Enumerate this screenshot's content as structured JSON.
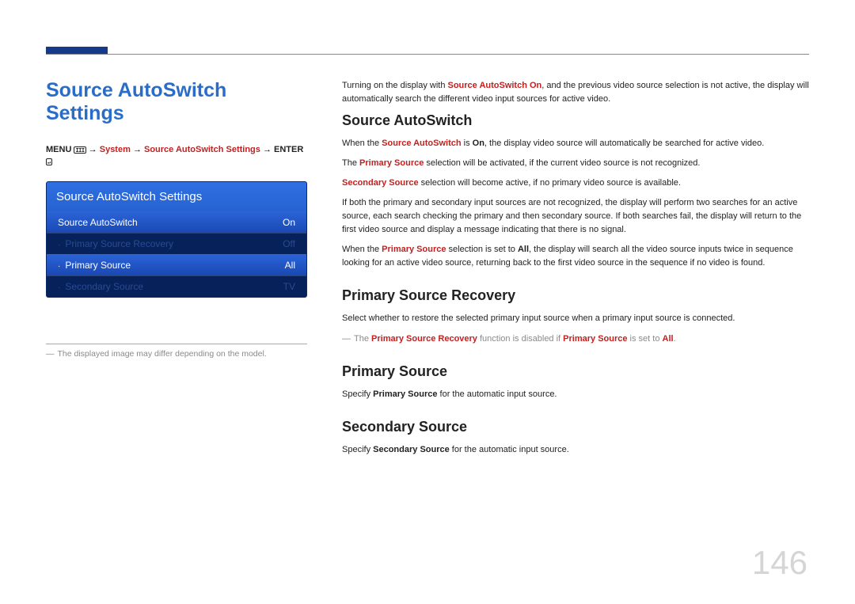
{
  "page_title": "Source AutoSwitch Settings",
  "breadcrumb": {
    "menu": "MENU",
    "menu_icon": "III",
    "arrow": "→",
    "system": "System",
    "page": "Source AutoSwitch Settings",
    "enter": "ENTER",
    "enter_icon": "↵"
  },
  "osd": {
    "title": "Source AutoSwitch Settings",
    "rows": [
      {
        "label": "Source AutoSwitch",
        "value": "On",
        "disabled": false,
        "bullet": false
      },
      {
        "label": "Primary Source Recovery",
        "value": "Off",
        "disabled": true,
        "bullet": true
      },
      {
        "label": "Primary Source",
        "value": "All",
        "disabled": false,
        "bullet": true
      },
      {
        "label": "Secondary Source",
        "value": "TV",
        "disabled": true,
        "bullet": true
      }
    ]
  },
  "footnote": "The displayed image may differ depending on the model.",
  "intro": {
    "p1a": "Turning on the display with ",
    "p1b": "Source AutoSwitch On",
    "p1c": ", and the previous video source selection is not active, the display will automatically search the different video input sources for active video."
  },
  "sections": {
    "autoswitch": {
      "heading": "Source AutoSwitch",
      "p1a": "When the ",
      "p1b": "Source AutoSwitch",
      "p1c": " is ",
      "p1d": "On",
      "p1e": ", the display video source will automatically be searched for active video.",
      "p2a": "The ",
      "p2b": "Primary Source",
      "p2c": " selection will be activated, if the current video source is not recognized.",
      "p3a": "Secondary Source",
      "p3b": " selection will become active, if no primary video source is available.",
      "p4": "If both the primary and secondary input sources are not recognized, the display will perform two searches for an active source, each search checking the primary and then secondary source. If both searches fail, the display will return to the first video source and display a message indicating that there is no signal.",
      "p5a": "When the ",
      "p5b": "Primary Source",
      "p5c": " selection is set to ",
      "p5d": "All",
      "p5e": ", the display will search all the video source inputs twice in sequence looking for an active video source, returning back to the first video source in the sequence if no video is found."
    },
    "recovery": {
      "heading": "Primary Source Recovery",
      "p1": "Select whether to restore the selected primary input source when a primary input source is connected.",
      "note_a": "The ",
      "note_b": "Primary Source Recovery",
      "note_c": " function is disabled if ",
      "note_d": "Primary Source",
      "note_e": " is set to ",
      "note_f": "All",
      "note_g": "."
    },
    "primary": {
      "heading": "Primary Source",
      "p1a": "Specify ",
      "p1b": "Primary Source",
      "p1c": " for the automatic input source."
    },
    "secondary": {
      "heading": "Secondary Source",
      "p1a": "Specify ",
      "p1b": "Secondary Source",
      "p1c": " for the automatic input source."
    }
  },
  "page_number": "146"
}
